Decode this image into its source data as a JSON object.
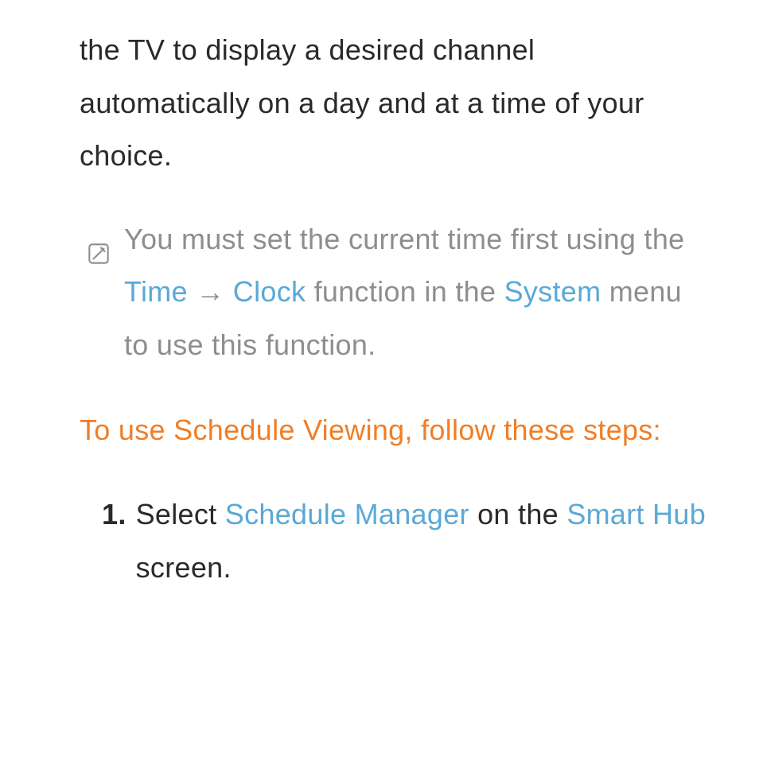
{
  "intro": "the TV to display a desired channel automatically on a day and at a time of your choice.",
  "note": {
    "part1": "You must set the current time first using the ",
    "time_label": "Time",
    "arrow": " → ",
    "clock_label": "Clock",
    "part2": " function in the ",
    "system_label": "System",
    "part3": " menu to use this function."
  },
  "heading": "To use Schedule Viewing, follow these steps:",
  "step1": {
    "number": "1.",
    "part1": "Select ",
    "schedule_manager": "Schedule Manager",
    "part2": " on the ",
    "smart_hub": "Smart Hub",
    "part3": " screen."
  }
}
